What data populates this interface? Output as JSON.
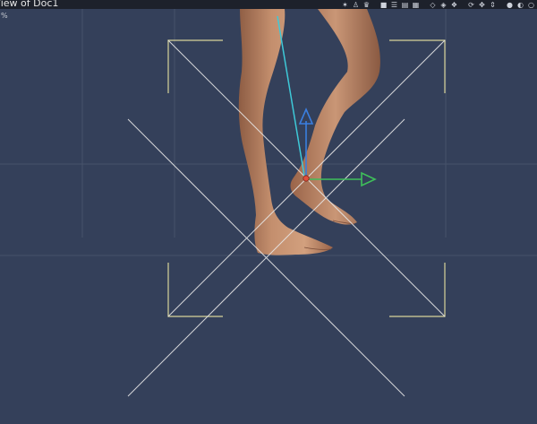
{
  "window": {
    "title": "/iew of Doc1",
    "zoom_label": "%"
  },
  "toolbar": {
    "icons": [
      {
        "name": "light-icon",
        "glyph": "✶"
      },
      {
        "name": "figure-icon",
        "glyph": "♙"
      },
      {
        "name": "group-icon",
        "glyph": "♛"
      },
      {
        "name": "single-view-icon",
        "glyph": "■"
      },
      {
        "name": "stack-view-icon",
        "glyph": "☰"
      },
      {
        "name": "split-view-icon",
        "glyph": "▤"
      },
      {
        "name": "quad-view-icon",
        "glyph": "▦"
      },
      {
        "name": "wire-cube-icon",
        "glyph": "◇"
      },
      {
        "name": "shaded-cube-icon",
        "glyph": "◈"
      },
      {
        "name": "texture-cube-icon",
        "glyph": "❖"
      },
      {
        "name": "rotate-tool-icon",
        "glyph": "⟳"
      },
      {
        "name": "translate-tool-icon",
        "glyph": "✥"
      },
      {
        "name": "scale-tool-icon",
        "glyph": "⇕"
      },
      {
        "name": "lit-sphere-icon",
        "glyph": "●"
      },
      {
        "name": "shaded-sphere-icon",
        "glyph": "◐"
      },
      {
        "name": "flat-sphere-icon",
        "glyph": "○"
      }
    ]
  },
  "colors": {
    "background": "#34405a",
    "grid": "#46526a",
    "frame": "#d8d49a",
    "cross": "#e8e8e8",
    "skin": "#c48f6e",
    "skin_shadow": "#8e5d44",
    "bone": "#3ec9d8",
    "axis_y": "#3a7ee0",
    "axis_x": "#3fbf5a",
    "pivot": "#e0503c"
  }
}
